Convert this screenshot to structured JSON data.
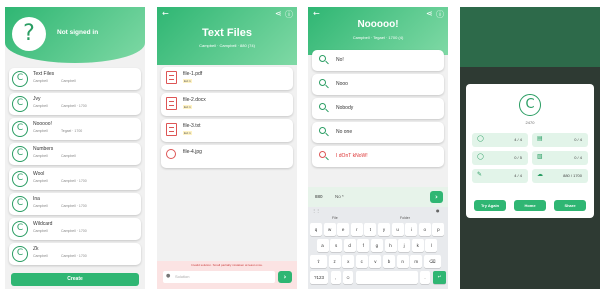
{
  "accent": "#2fb673",
  "screen1": {
    "header_avatar": "?",
    "header_title": "Not signed in",
    "items": [
      {
        "avatar": "C",
        "title": "Text Files",
        "sub1": "Campbell",
        "sub2": "Campbell"
      },
      {
        "avatar": "C",
        "title": "Jvy",
        "sub1": "Campbell",
        "sub2": "Campbell · 1700"
      },
      {
        "avatar": "C",
        "title": "Nooooo!",
        "sub1": "Campbell",
        "sub2": "Tegael · 1700"
      },
      {
        "avatar": "C",
        "title": "Numbers",
        "sub1": "Campbell",
        "sub2": "Campbell"
      },
      {
        "avatar": "C",
        "title": "Wool",
        "sub1": "Campbell",
        "sub2": "Campbell · 1700"
      },
      {
        "avatar": "C",
        "title": "Ina",
        "sub1": "Campbell",
        "sub2": "Campbell · 1700"
      },
      {
        "avatar": "C",
        "title": "Wildcard",
        "sub1": "Campbell",
        "sub2": "Campbell · 1700"
      },
      {
        "avatar": "C",
        "title": "Zk",
        "sub1": "Campbell",
        "sub2": "Campbell · 1700"
      }
    ],
    "create_label": "Create"
  },
  "screen2": {
    "title": "Text Files",
    "subtitle": "Campbell · Campbell · 880 (74)",
    "files": [
      {
        "name": "file-1.pdf",
        "badge": "Ext 1",
        "icon": "document-search-icon"
      },
      {
        "name": "file-2.docx",
        "badge": "Ext 1",
        "icon": "document-search-icon"
      },
      {
        "name": "file-3.txt",
        "badge": "Ext 1",
        "icon": "document-search-icon"
      },
      {
        "name": "file-4.jpg",
        "badge": "",
        "icon": "image-search-icon"
      }
    ],
    "notice": "Invalid solution. Small partially mistaken at least once.",
    "input_placeholder": "Solution"
  },
  "screen3": {
    "title": "Nooooo!",
    "subtitle": "Campbell · Tegael · 1700 (4)",
    "guesses": [
      {
        "text": "No!",
        "wrong": false
      },
      {
        "text": "Nooo",
        "wrong": false
      },
      {
        "text": "Nobody",
        "wrong": false
      },
      {
        "text": "No one",
        "wrong": false
      },
      {
        "text": "I dOnT kNoW!",
        "wrong": true
      }
    ],
    "input_score": "880",
    "input_value": "No *",
    "suggestions": [
      "File",
      "Folder"
    ],
    "keyboard_rows": [
      [
        "q",
        "w",
        "e",
        "r",
        "t",
        "y",
        "u",
        "i",
        "o",
        "p"
      ],
      [
        "a",
        "s",
        "d",
        "f",
        "g",
        "h",
        "j",
        "k",
        "l"
      ],
      [
        "⇧",
        "z",
        "x",
        "c",
        "v",
        "b",
        "n",
        "m",
        "⌫"
      ],
      [
        "?123",
        ",",
        "☺",
        "",
        "."
      ]
    ]
  },
  "screen4": {
    "avatar": "C",
    "score": "2470",
    "stats": [
      {
        "icon": "search-icon",
        "value": "4 / 4"
      },
      {
        "icon": "file-icon",
        "value": "0 / 4"
      },
      {
        "icon": "search-icon",
        "value": "0 / 5"
      },
      {
        "icon": "image-icon",
        "value": "0 / 4"
      },
      {
        "icon": "pencil-icon",
        "value": "4 / 4"
      },
      {
        "icon": "cloud-icon",
        "value": "880 / 1700"
      }
    ],
    "buttons": [
      "Try Again",
      "Home",
      "Share"
    ]
  }
}
